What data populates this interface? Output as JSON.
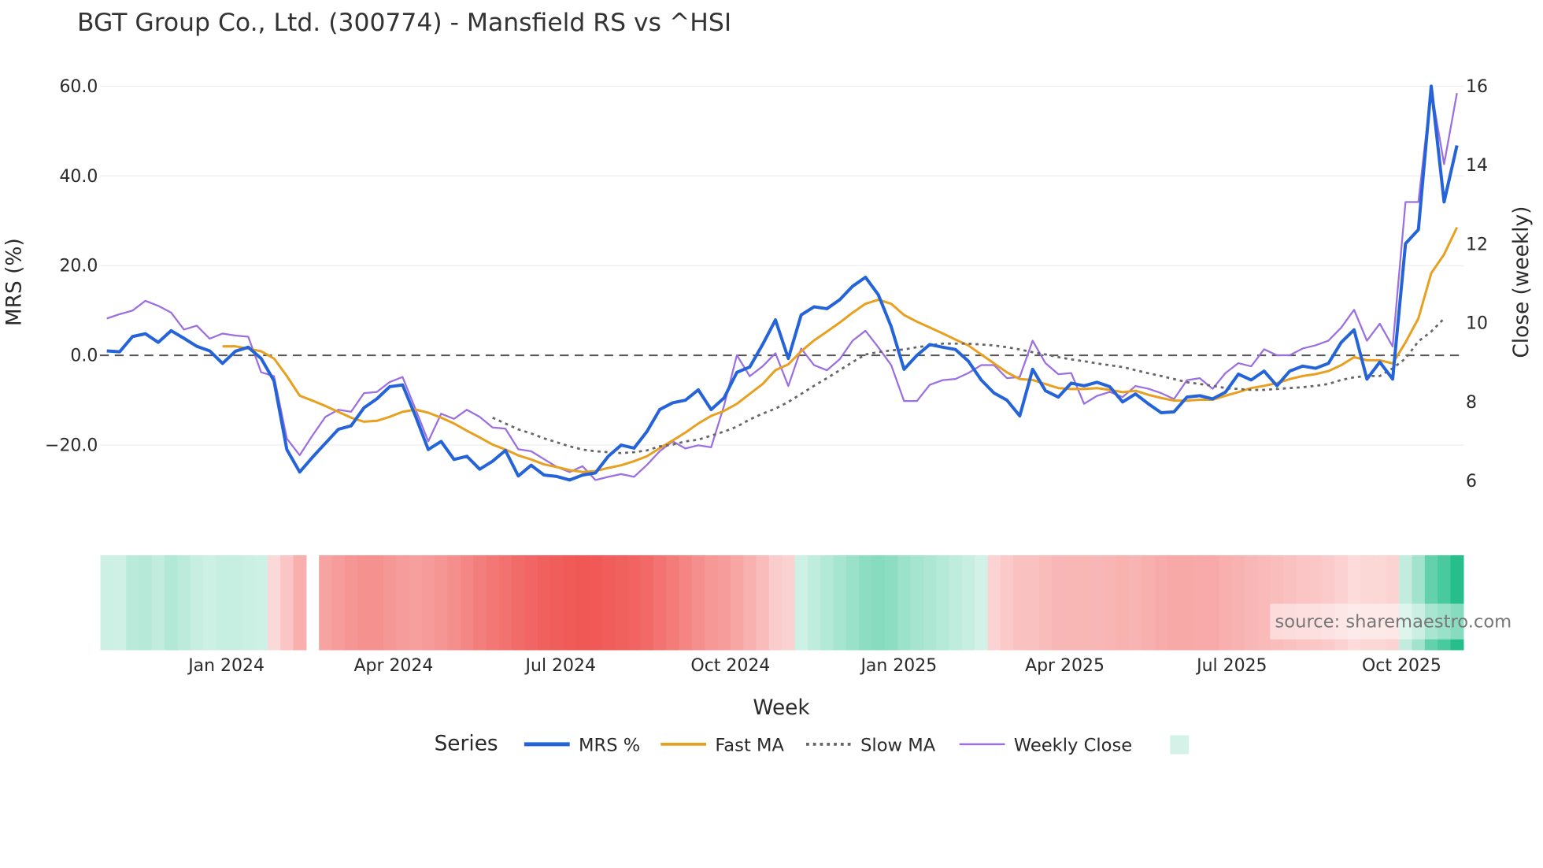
{
  "chart_data": {
    "type": "line",
    "title": "BGT Group Co., Ltd. (300774) - Mansfield RS vs ^HSI",
    "xlabel": "Week",
    "ylabel": "MRS (%)",
    "y2label": "Close (weekly)",
    "ylim": [
      -30,
      62
    ],
    "y2lim": [
      5.6,
      16.35
    ],
    "yticks": [
      "60.0",
      "40.0",
      "20.0",
      "0.0",
      "−20.0"
    ],
    "ytick_values": [
      60,
      40,
      20,
      0,
      -20
    ],
    "y2ticks": [
      16,
      14,
      12,
      10,
      8,
      6
    ],
    "xticks": [
      {
        "label": "Jan 2024",
        "week_index": 9.3
      },
      {
        "label": "Apr 2024",
        "week_index": 22.3
      },
      {
        "label": "Jul 2024",
        "week_index": 35.3
      },
      {
        "label": "Oct 2024",
        "week_index": 48.5
      },
      {
        "label": "Jan 2025",
        "week_index": 61.6
      },
      {
        "label": "Apr 2025",
        "week_index": 74.5
      },
      {
        "label": "Jul 2025",
        "week_index": 87.5
      },
      {
        "label": "Oct 2025",
        "week_index": 100.7
      }
    ],
    "grid": true,
    "legend_title": "Series",
    "legend_placement": "bottom",
    "source": "source: sharemaestro.com",
    "strip_gap_week": 16,
    "series": [
      {
        "name": "MRS %",
        "color": "#2563d9",
        "axis": "left",
        "start": 0,
        "values": [
          1,
          0.8,
          4.2,
          4.8,
          2.9,
          5.5,
          3.8,
          2,
          1,
          -1.8,
          0.9,
          1.8,
          -0.7,
          -5.7,
          -21,
          -26,
          -22.7,
          -19.6,
          -16.5,
          -15.7,
          -11.7,
          -9.7,
          -7,
          -6.6,
          -13.5,
          -21,
          -19.2,
          -23.2,
          -22.5,
          -25.4,
          -23.6,
          -21.2,
          -26.9,
          -24.5,
          -26.7,
          -27,
          -27.8,
          -26.7,
          -26.2,
          -22.5,
          -20,
          -20.7,
          -17,
          -12.1,
          -10.6,
          -10,
          -7.7,
          -12.1,
          -9.5,
          -3.8,
          -2.6,
          2.4,
          7.9,
          -0.7,
          9,
          10.8,
          10.4,
          12.4,
          15.4,
          17.4,
          13.5,
          6.4,
          -3.1,
          0,
          2.4,
          1.8,
          1.3,
          -1.3,
          -5.5,
          -8.4,
          -10,
          -13.5,
          -3.1,
          -7.9,
          -9.3,
          -6.2,
          -6.8,
          -6,
          -7,
          -10.4,
          -8.6,
          -10.8,
          -12.8,
          -12.6,
          -9.3,
          -9,
          -9.7,
          -8.2,
          -4.2,
          -5.5,
          -3.5,
          -6.8,
          -3.5,
          -2.4,
          -2.9,
          -1.8,
          2.9,
          5.7,
          -5.3,
          -1.5,
          -5.3,
          24.9,
          28,
          60,
          34.2,
          46.8
        ]
      },
      {
        "name": "Fast MA",
        "color": "#e8a020",
        "axis": "left",
        "start": 9,
        "values": [
          2,
          2,
          1.5,
          0.9,
          -0.7,
          -4.6,
          -9,
          -10.1,
          -11.3,
          -12.6,
          -13.9,
          -14.8,
          -14.6,
          -13.7,
          -12.6,
          -12.1,
          -12.8,
          -13.9,
          -15.2,
          -16.8,
          -18.3,
          -19.9,
          -21,
          -22.3,
          -23.2,
          -24.3,
          -24.9,
          -25.6,
          -26,
          -25.8,
          -25.1,
          -24.5,
          -23.6,
          -22.5,
          -20.7,
          -19,
          -17.2,
          -15.2,
          -13.5,
          -12.4,
          -10.8,
          -8.6,
          -6.4,
          -3.3,
          -2,
          0.9,
          3.3,
          5.3,
          7.3,
          9.5,
          11.5,
          12.4,
          11.5,
          9,
          7.5,
          6.2,
          4.9,
          3.5,
          2.2,
          0.2,
          -1.8,
          -3.8,
          -5.3,
          -5.5,
          -6.4,
          -7.3,
          -7.5,
          -7.5,
          -7.3,
          -7.7,
          -8.2,
          -7.9,
          -8.8,
          -9.5,
          -10.1,
          -10.1,
          -9.9,
          -9.9,
          -9,
          -8.2,
          -7.3,
          -6.8,
          -6.2,
          -5.3,
          -4.6,
          -4.2,
          -3.5,
          -2.2,
          -0.4,
          -1.1,
          -1.1,
          -1.8,
          2.9,
          8.2,
          18.3,
          22.5,
          28.5
        ]
      },
      {
        "name": "Slow MA",
        "color": "#666666",
        "axis": "left",
        "start": 30,
        "values": [
          -13.9,
          -15.2,
          -16.5,
          -17.4,
          -18.5,
          -19.4,
          -20.3,
          -21,
          -21.4,
          -21.6,
          -21.8,
          -21.6,
          -21.2,
          -20.3,
          -19.9,
          -19.2,
          -18.8,
          -17.9,
          -17,
          -15.9,
          -14.3,
          -13,
          -11.9,
          -10.4,
          -8.6,
          -6.8,
          -5.1,
          -3.3,
          -1.5,
          0.2,
          0.7,
          1.1,
          1.3,
          1.8,
          2.2,
          2.6,
          2.6,
          2.6,
          2.4,
          2.2,
          1.8,
          1.3,
          0.7,
          0.2,
          -0.4,
          -0.9,
          -1.3,
          -1.8,
          -2.2,
          -2.6,
          -3.3,
          -4,
          -4.6,
          -5.3,
          -6,
          -6.4,
          -6.8,
          -7.3,
          -7.5,
          -7.7,
          -7.7,
          -7.5,
          -7.3,
          -7.1,
          -6.8,
          -6.4,
          -5.5,
          -4.9,
          -4.6,
          -4.6,
          -2.9,
          -0.7,
          3.1,
          5.3,
          8.2
        ]
      },
      {
        "name": "Weekly Close",
        "color": "#9b6fe0",
        "axis": "right",
        "start": 0,
        "values": [
          10.09,
          10.2,
          10.29,
          10.54,
          10.41,
          10.24,
          9.81,
          9.91,
          9.58,
          9.71,
          9.66,
          9.63,
          8.73,
          8.63,
          7.05,
          6.63,
          7.13,
          7.6,
          7.78,
          7.73,
          8.2,
          8.23,
          8.48,
          8.61,
          7.8,
          6.98,
          7.68,
          7.55,
          7.78,
          7.6,
          7.33,
          7.3,
          6.78,
          6.73,
          6.53,
          6.33,
          6.2,
          6.35,
          6.0,
          6.08,
          6.15,
          6.08,
          6.38,
          6.73,
          6.98,
          6.8,
          6.88,
          6.83,
          7.88,
          9.16,
          8.63,
          8.88,
          9.21,
          8.38,
          9.33,
          8.91,
          8.78,
          9.06,
          9.53,
          9.78,
          9.36,
          8.91,
          8.0,
          8.0,
          8.41,
          8.53,
          8.56,
          8.71,
          8.91,
          8.91,
          8.58,
          8.61,
          9.53,
          8.96,
          8.68,
          8.71,
          7.93,
          8.13,
          8.23,
          8.1,
          8.38,
          8.31,
          8.2,
          8.05,
          8.53,
          8.58,
          8.31,
          8.71,
          8.96,
          8.88,
          9.31,
          9.16,
          9.16,
          9.33,
          9.41,
          9.53,
          9.86,
          10.31,
          9.53,
          9.96,
          9.38,
          13.04,
          13.04,
          15.9,
          14.0,
          15.8
        ]
      }
    ],
    "strip_colors": {
      "negative": "#ef5350",
      "neutral": "#ffffff",
      "positive": "#26bf8c",
      "legend_swatch": "#d4f2e8"
    }
  }
}
